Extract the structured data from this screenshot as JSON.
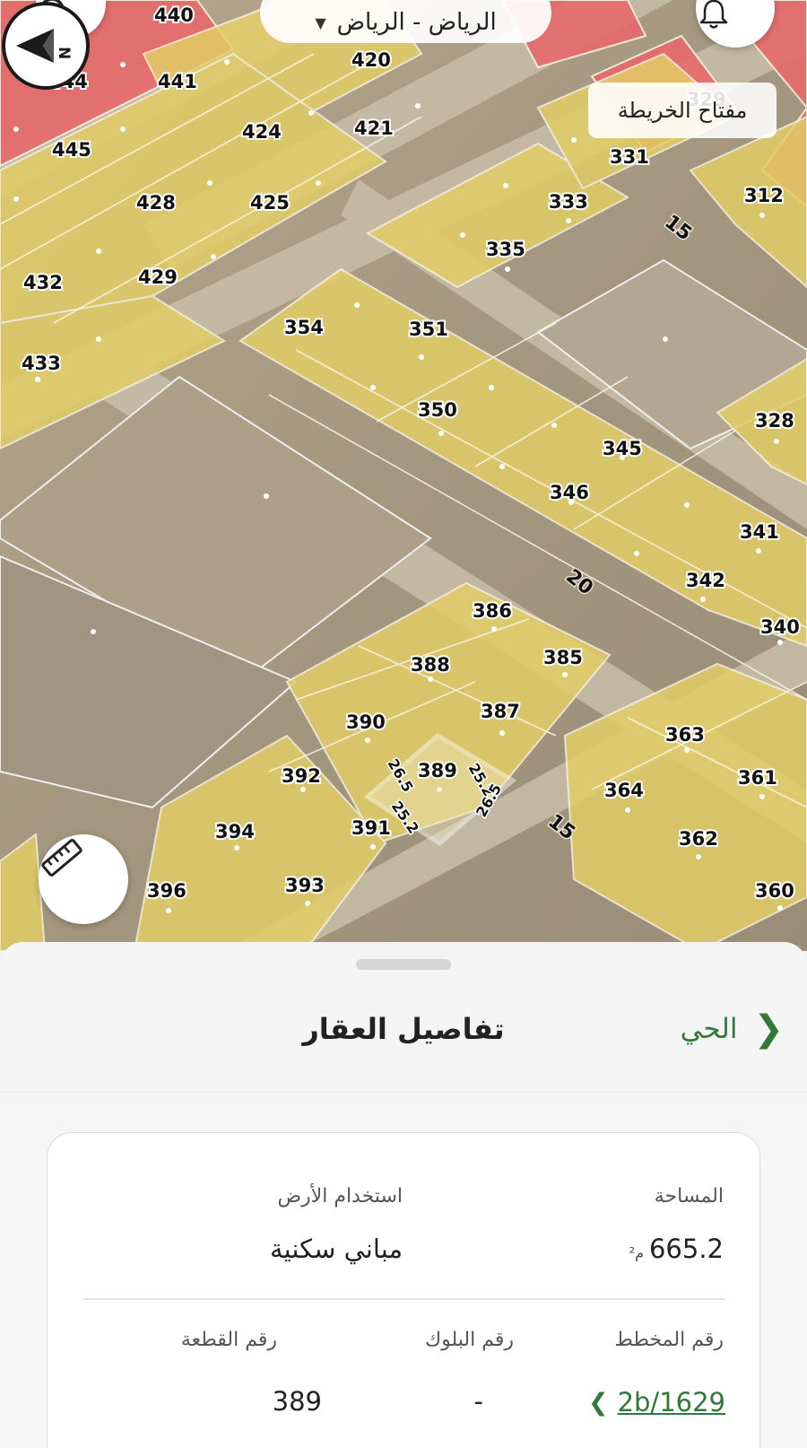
{
  "map": {
    "location_label": "الرياض - الرياض",
    "legend_label": "مفتاح الخريطة",
    "compass_letter": "N",
    "parcel_labels": [
      "440",
      "444",
      "441",
      "420",
      "445",
      "424",
      "421",
      "428",
      "425",
      "432",
      "429",
      "354",
      "351",
      "433",
      "350",
      "345",
      "346",
      "341",
      "342",
      "386",
      "385",
      "388",
      "387",
      "390",
      "389",
      "392",
      "391",
      "394",
      "396",
      "393",
      "363",
      "364",
      "361",
      "362",
      "360",
      "331",
      "333",
      "335",
      "312",
      "328",
      "340",
      "329"
    ],
    "road_labels": [
      "15",
      "20",
      "15"
    ],
    "dimensions": [
      "25.2",
      "26.5",
      "25.2",
      "26.5"
    ],
    "colors": {
      "residential": "#e0c95a",
      "commercial": "#e86466",
      "selected": "#ffffff"
    }
  },
  "sheet": {
    "title": "تفاصيل العقار",
    "back_label": "الحي",
    "details": {
      "area_label": "المساحة",
      "area_value": "665.2",
      "area_unit": "م²",
      "land_use_label": "استخدام الأرض",
      "land_use_value": "مباني سكنية",
      "plan_label": "رقم المخطط",
      "plan_value": "2b/1629",
      "block_label": "رقم البلوك",
      "block_value": "-",
      "parcel_label": "رقم القطعة",
      "parcel_value": "389"
    }
  },
  "icons": {
    "search": "search-icon",
    "bell": "bell-icon",
    "ruler": "ruler-icon",
    "compass": "compass-icon",
    "back": "chevron-right-icon",
    "plan": "chevron-left-icon"
  }
}
